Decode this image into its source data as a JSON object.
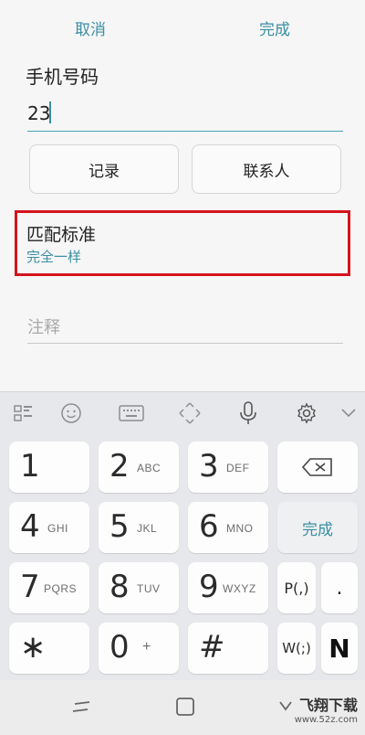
{
  "topbar": {
    "cancel_label": "取消",
    "done_label": "完成"
  },
  "form": {
    "phone_label": "手机号码",
    "phone_value": "23",
    "record_button": "记录",
    "contacts_button": "联系人",
    "match_title": "匹配标准",
    "match_value": "完全一样",
    "note_placeholder": "注释"
  },
  "keyboard": {
    "keys": [
      {
        "digit": "1",
        "sub": ""
      },
      {
        "digit": "2",
        "sub": "ABC"
      },
      {
        "digit": "3",
        "sub": "DEF"
      },
      {
        "digit": "4",
        "sub": "GHI"
      },
      {
        "digit": "5",
        "sub": "JKL"
      },
      {
        "digit": "6",
        "sub": "MNO"
      },
      {
        "digit": "7",
        "sub": "PQRS"
      },
      {
        "digit": "8",
        "sub": "TUV"
      },
      {
        "digit": "9",
        "sub": "WXYZ"
      },
      {
        "digit": "0",
        "sub": "+"
      },
      {
        "digit": "#",
        "sub": ""
      }
    ],
    "done_key": "完成",
    "pause_key": "P(,)",
    "wait_key": "W(;)",
    "dot_key": ".",
    "n_key": "N",
    "star_key": "∗"
  },
  "watermark": {
    "title": "飞翔下载",
    "url": "www.52z.com"
  },
  "colors": {
    "accent": "#3a8fa3",
    "highlight_border": "#d4141c"
  }
}
